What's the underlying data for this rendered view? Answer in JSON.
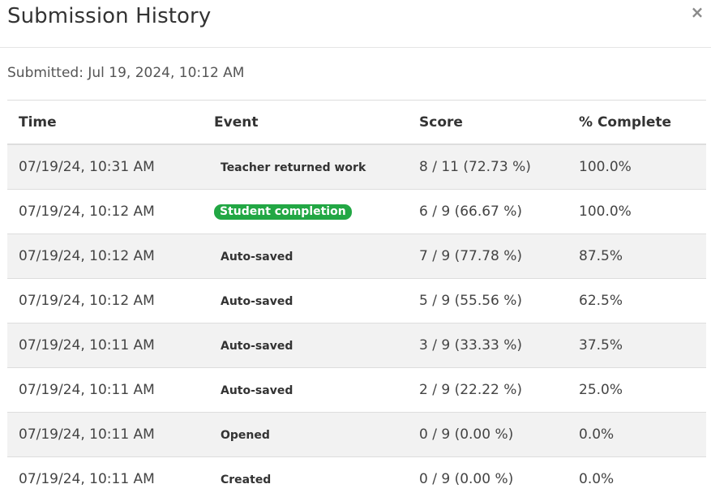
{
  "dialog": {
    "title": "Submission History",
    "close_label": "×",
    "submitted": "Submitted: Jul 19, 2024, 10:12 AM"
  },
  "table": {
    "headers": {
      "time": "Time",
      "event": "Event",
      "score": "Score",
      "complete": "% Complete"
    },
    "rows": [
      {
        "time": "07/19/24, 10:31 AM",
        "event": "Teacher returned work",
        "score": "8 / 11 (72.73 %)",
        "complete": "100.0%"
      },
      {
        "time": "07/19/24, 10:12 AM",
        "event": "Student completion",
        "score": "6 / 9 (66.67 %)",
        "complete": "100.0%"
      },
      {
        "time": "07/19/24, 10:12 AM",
        "event": "Auto-saved",
        "score": "7 / 9 (77.78 %)",
        "complete": "87.5%"
      },
      {
        "time": "07/19/24, 10:12 AM",
        "event": "Auto-saved",
        "score": "5 / 9 (55.56 %)",
        "complete": "62.5%"
      },
      {
        "time": "07/19/24, 10:11 AM",
        "event": "Auto-saved",
        "score": "3 / 9 (33.33 %)",
        "complete": "37.5%"
      },
      {
        "time": "07/19/24, 10:11 AM",
        "event": "Auto-saved",
        "score": "2 / 9 (22.22 %)",
        "complete": "25.0%"
      },
      {
        "time": "07/19/24, 10:11 AM",
        "event": "Opened",
        "score": "0 / 9 (0.00 %)",
        "complete": "0.0%"
      },
      {
        "time": "07/19/24, 10:11 AM",
        "event": "Created",
        "score": "0 / 9 (0.00 %)",
        "complete": "0.0%"
      }
    ]
  },
  "colors": {
    "badge_green": "#22a744",
    "row_stripe": "#f2f2f2",
    "border": "#dddddd"
  }
}
